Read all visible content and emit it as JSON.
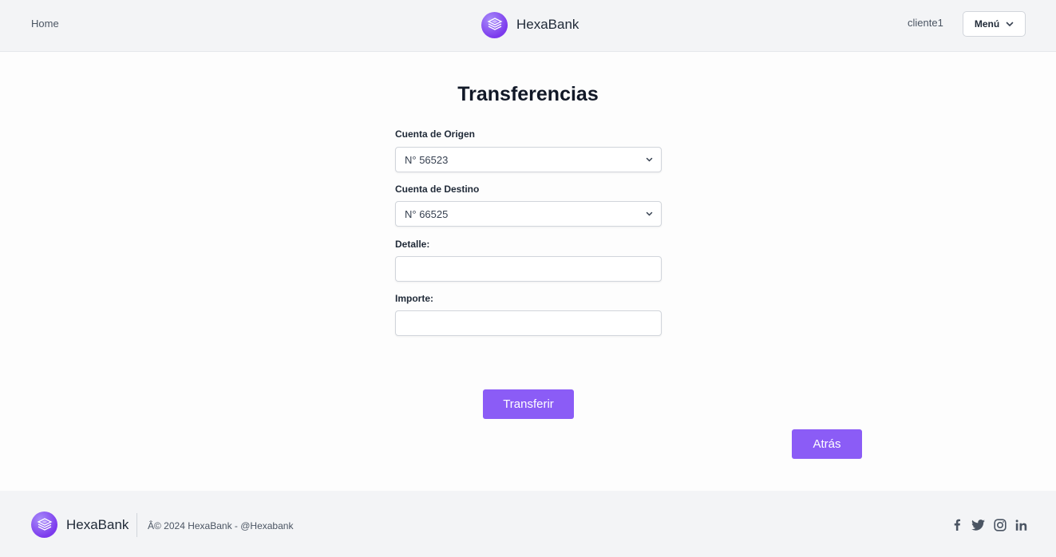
{
  "header": {
    "home_label": "Home",
    "brand_name": "HexaBank",
    "username": "cliente1",
    "menu_label": "Menú"
  },
  "main": {
    "title": "Transferencias",
    "origin": {
      "label": "Cuenta de Origen",
      "value": "N° 56523"
    },
    "destination": {
      "label": "Cuenta de Destino",
      "value": "N° 66525"
    },
    "detail": {
      "label": "Detalle:",
      "value": "",
      "placeholder": ""
    },
    "amount": {
      "label": "Importe:",
      "value": "",
      "placeholder": ""
    },
    "transfer_button": "Transferir",
    "back_button": "Atrás"
  },
  "footer": {
    "brand_name": "HexaBank",
    "copyright": "Â© 2024 HexaBank  - @Hexabank",
    "socials": [
      "facebook-icon",
      "twitter-icon",
      "instagram-icon",
      "linkedin-icon"
    ]
  },
  "colors": {
    "accent": "#8b5cf6",
    "header_bg": "#f3f4f6",
    "footer_bg": "#f3f4f6"
  }
}
